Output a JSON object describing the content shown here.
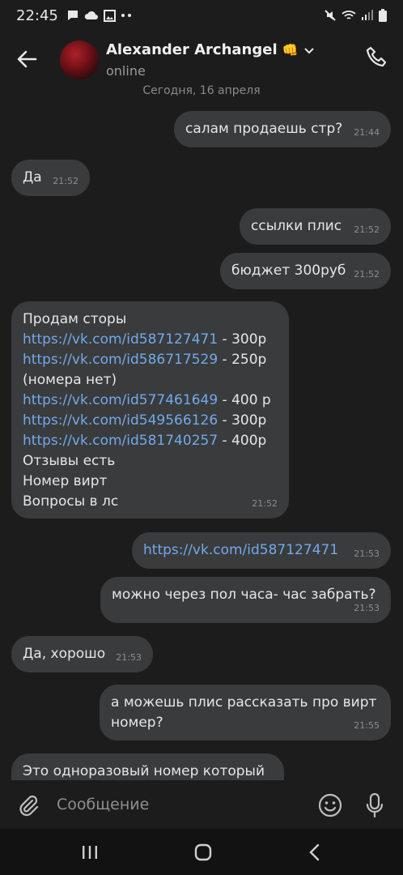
{
  "status_bar": {
    "time": "22:45"
  },
  "header": {
    "contact_name": "Alexander Archangel",
    "name_emoji": "👊",
    "presence": "online"
  },
  "date_divider": "Сегодня, 16 апреля",
  "messages": [
    {
      "direction": "outgoing",
      "lines": [
        "салам продаешь стр?"
      ],
      "time": "21:44"
    },
    {
      "direction": "incoming",
      "lines": [
        "Да"
      ],
      "time": "21:52"
    },
    {
      "direction": "outgoing",
      "lines": [
        "ссылки плис"
      ],
      "time": "21:52"
    },
    {
      "direction": "outgoing",
      "lines": [
        "бюджет 300руб"
      ],
      "time": "21:52"
    },
    {
      "direction": "incoming",
      "intro": "Продам сторы",
      "offers": [
        {
          "link": "https://vk.com/id587127471",
          "price": " - 300р"
        },
        {
          "link": "https://vk.com/id586717529",
          "price": " - 250р"
        }
      ],
      "note": "(номера нет)",
      "offers2": [
        {
          "link": "https://vk.com/id577461649",
          "price": " - 400 р"
        },
        {
          "link": "https://vk.com/id549566126",
          "price": " - 300р"
        },
        {
          "link": "https://vk.com/id581740257",
          "price": " - 400р"
        }
      ],
      "outro": [
        "Отзывы есть",
        "Номер вирт",
        "Вопросы в лс"
      ],
      "time": "21:52"
    },
    {
      "direction": "outgoing",
      "link": "https://vk.com/id587127471",
      "time": "21:53"
    },
    {
      "direction": "outgoing",
      "lines": [
        "можно через пол часа- час забрать?"
      ],
      "time": "21:53"
    },
    {
      "direction": "incoming",
      "lines": [
        "Да, хорошо"
      ],
      "time": "21:53"
    },
    {
      "direction": "outgoing",
      "lines": [
        "а можешь плис рассказать про вирт",
        "номер?"
      ],
      "time": "21:55"
    },
    {
      "direction": "incoming",
      "lines": [
        "Это одноразовый номер который"
      ],
      "time": ""
    }
  ],
  "composer": {
    "placeholder": "Сообщение"
  },
  "icons": {
    "status": [
      "notification-icon",
      "chat-icon",
      "cloud-icon",
      "image-icon",
      "more-dots-icon",
      "mute-icon",
      "wifi-icon",
      "signal-icon",
      "battery-icon"
    ],
    "header": [
      "back-arrow-icon",
      "chevron-down-icon",
      "phone-icon"
    ],
    "composer": [
      "paperclip-icon",
      "emoji-icon",
      "microphone-icon"
    ],
    "navbar": [
      "recents-icon",
      "home-icon",
      "nav-back-icon"
    ]
  },
  "colors": {
    "bubble": "#3a3b3c",
    "link": "#71aaeb",
    "background": "#1c1c1d"
  }
}
